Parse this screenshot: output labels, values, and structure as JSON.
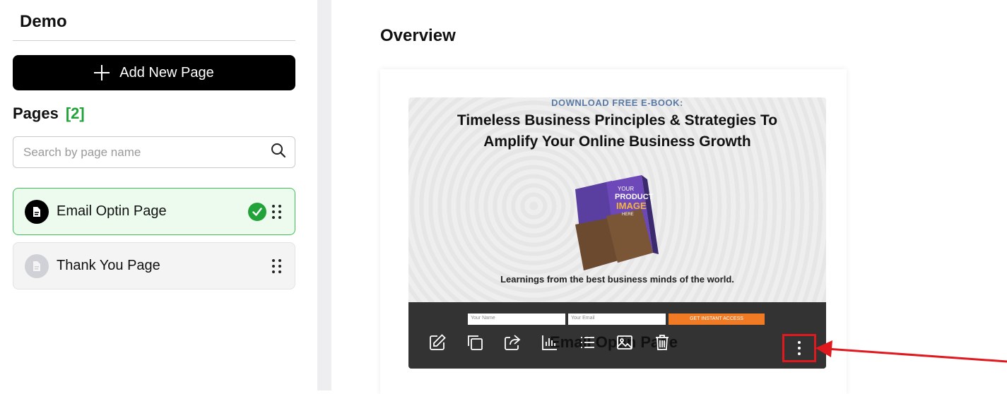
{
  "sidebar": {
    "funnel_title": "Demo",
    "add_button_label": "Add New Page",
    "pages_label": "Pages",
    "pages_count": "[2]",
    "search_placeholder": "Search by page name",
    "pages": [
      {
        "label": "Email Optin Page",
        "active": true,
        "published": true
      },
      {
        "label": "Thank You Page",
        "active": false,
        "published": false
      }
    ]
  },
  "main": {
    "title": "Overview",
    "preview": {
      "kicker": "DOWNLOAD FREE E-BOOK:",
      "headline": "Timeless Business Principles & Strategies To Amplify Your Online Business Growth",
      "book_text_1": "YOUR",
      "book_text_2": "PRODUCT",
      "book_text_3": "IMAGE",
      "book_text_4": "HERE",
      "subline": "Learnings from the best business minds of the world.",
      "field_name": "Your Name",
      "field_email": "Your Email",
      "cta": "GET INSTANT ACCESS",
      "overlay_name": "Email Optin Page"
    },
    "toolbar": [
      "edit-icon",
      "duplicate-icon",
      "share-icon",
      "stats-icon",
      "list-icon",
      "image-icon",
      "trash-icon",
      "more-vertical-icon"
    ]
  },
  "colors": {
    "accent_green": "#21a339",
    "highlight_red": "#e0191f",
    "cta_orange": "#f07b24"
  }
}
